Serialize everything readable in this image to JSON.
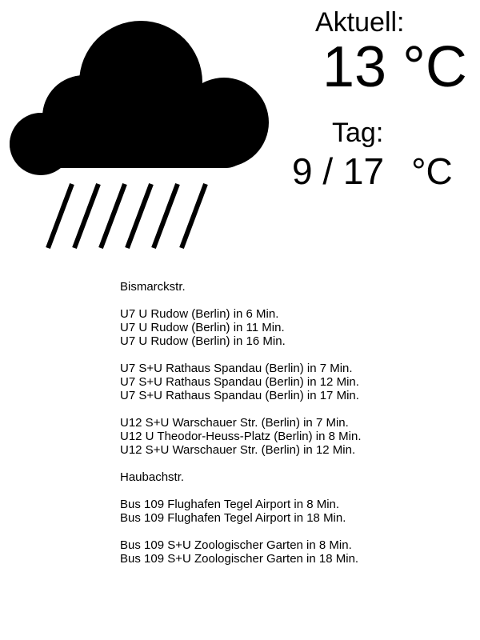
{
  "weather": {
    "icon": "rain-cloud-icon",
    "current_label": "Aktuell:",
    "current_temp": "13 °C",
    "day_label": "Tag:",
    "day_range": "9 / 17",
    "day_unit": "°C"
  },
  "departures": [
    {
      "station": "Bismarckstr.",
      "groups": [
        [
          "U7 U Rudow (Berlin) in 6 Min.",
          "U7 U Rudow (Berlin) in 11 Min.",
          "U7 U Rudow (Berlin) in 16 Min."
        ],
        [
          "U7 S+U Rathaus Spandau (Berlin) in 7 Min.",
          "U7 S+U Rathaus Spandau (Berlin) in 12 Min.",
          "U7 S+U Rathaus Spandau (Berlin) in 17 Min."
        ],
        [
          "U12 S+U Warschauer Str. (Berlin) in 7 Min.",
          "U12 U Theodor-Heuss-Platz (Berlin) in 8 Min.",
          "U12 S+U Warschauer Str. (Berlin) in 12 Min."
        ]
      ]
    },
    {
      "station": "Haubachstr.",
      "groups": [
        [
          "Bus 109 Flughafen Tegel Airport in 8 Min.",
          "Bus 109 Flughafen Tegel Airport in 18 Min."
        ],
        [
          "Bus 109 S+U Zoologischer Garten in 8 Min.",
          "Bus 109 S+U Zoologischer Garten in 18 Min."
        ]
      ]
    }
  ]
}
